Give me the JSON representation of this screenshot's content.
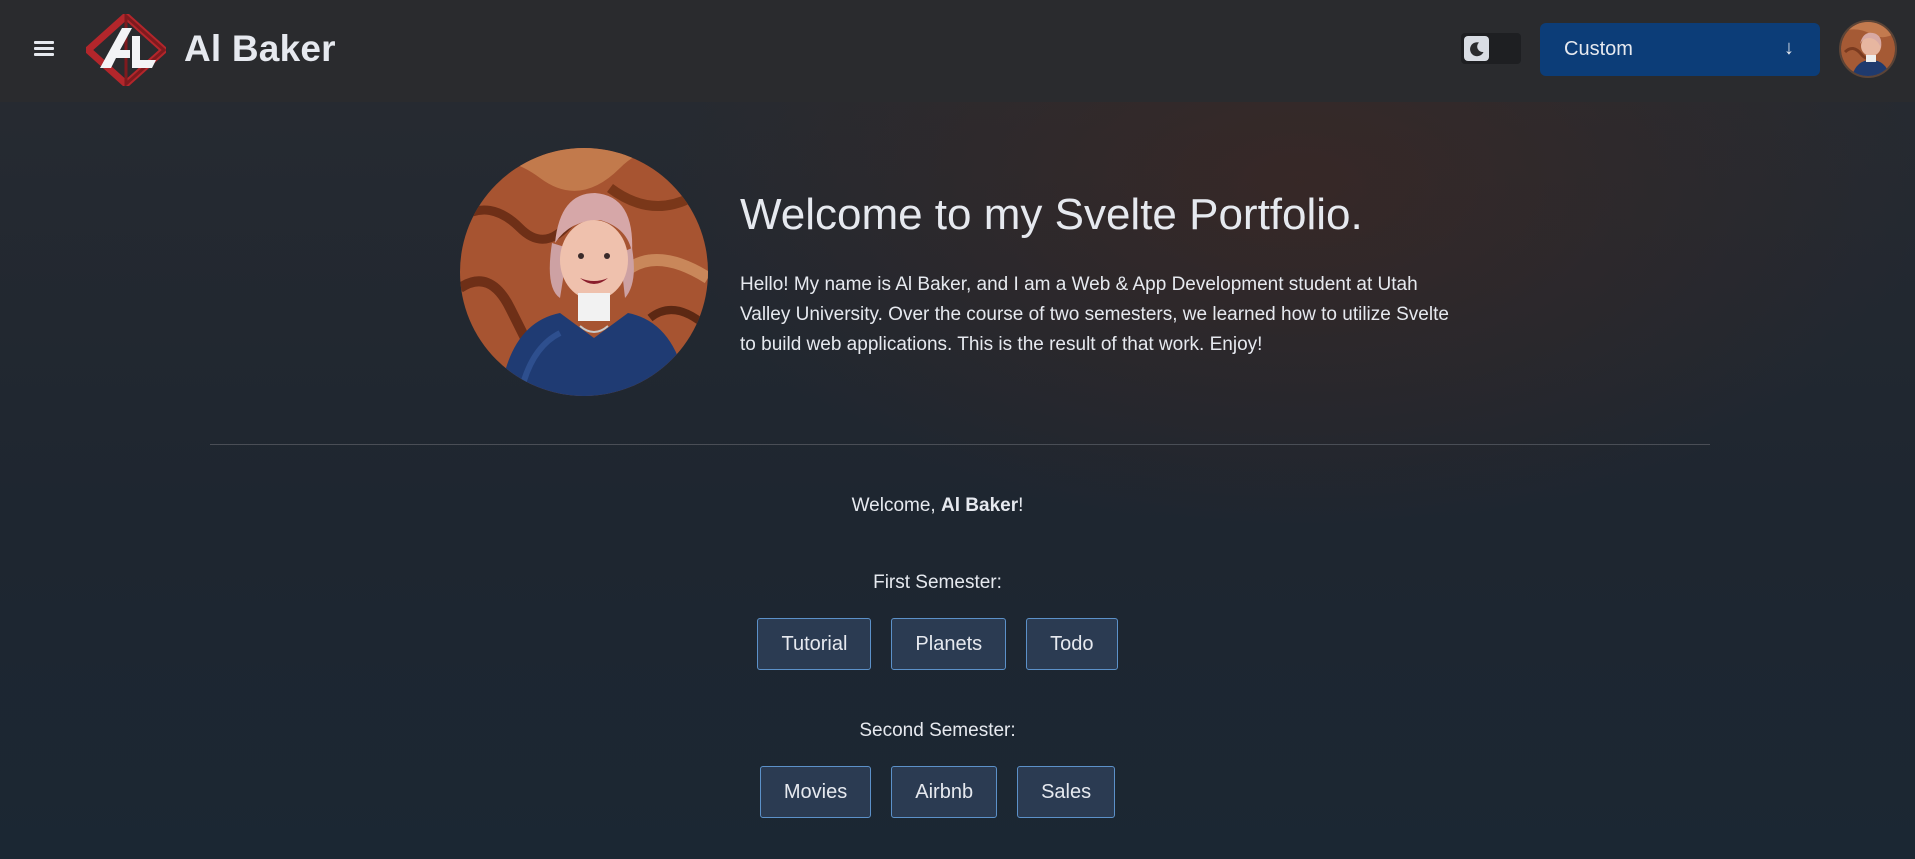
{
  "header": {
    "brand": "Al Baker",
    "theme_toggle_icon": "moon-icon",
    "theme_select": {
      "selected": "Custom",
      "arrow": "↓"
    },
    "colors": {
      "bar": "#2a2b2e",
      "select": "#0c3d78",
      "logo_red": "#b3262b"
    }
  },
  "hero": {
    "title": "Welcome to my Svelte Portfolio.",
    "intro": "Hello! My name is Al Baker, and I am a Web & App Development student at Utah Valley University. Over the course of two semesters, we learned how to utilize Svelte to build web applications. This is the result of that work. Enjoy!"
  },
  "greeting": {
    "prefix": "Welcome, ",
    "name": "Al Baker",
    "suffix": "!"
  },
  "semesters": [
    {
      "label": "First Semester:",
      "projects": [
        "Tutorial",
        "Planets",
        "Todo"
      ]
    },
    {
      "label": "Second Semester:",
      "projects": [
        "Movies",
        "Airbnb",
        "Sales"
      ]
    }
  ],
  "accent": {
    "button_border": "#5c91c9",
    "button_bg": "#2b3b52"
  }
}
